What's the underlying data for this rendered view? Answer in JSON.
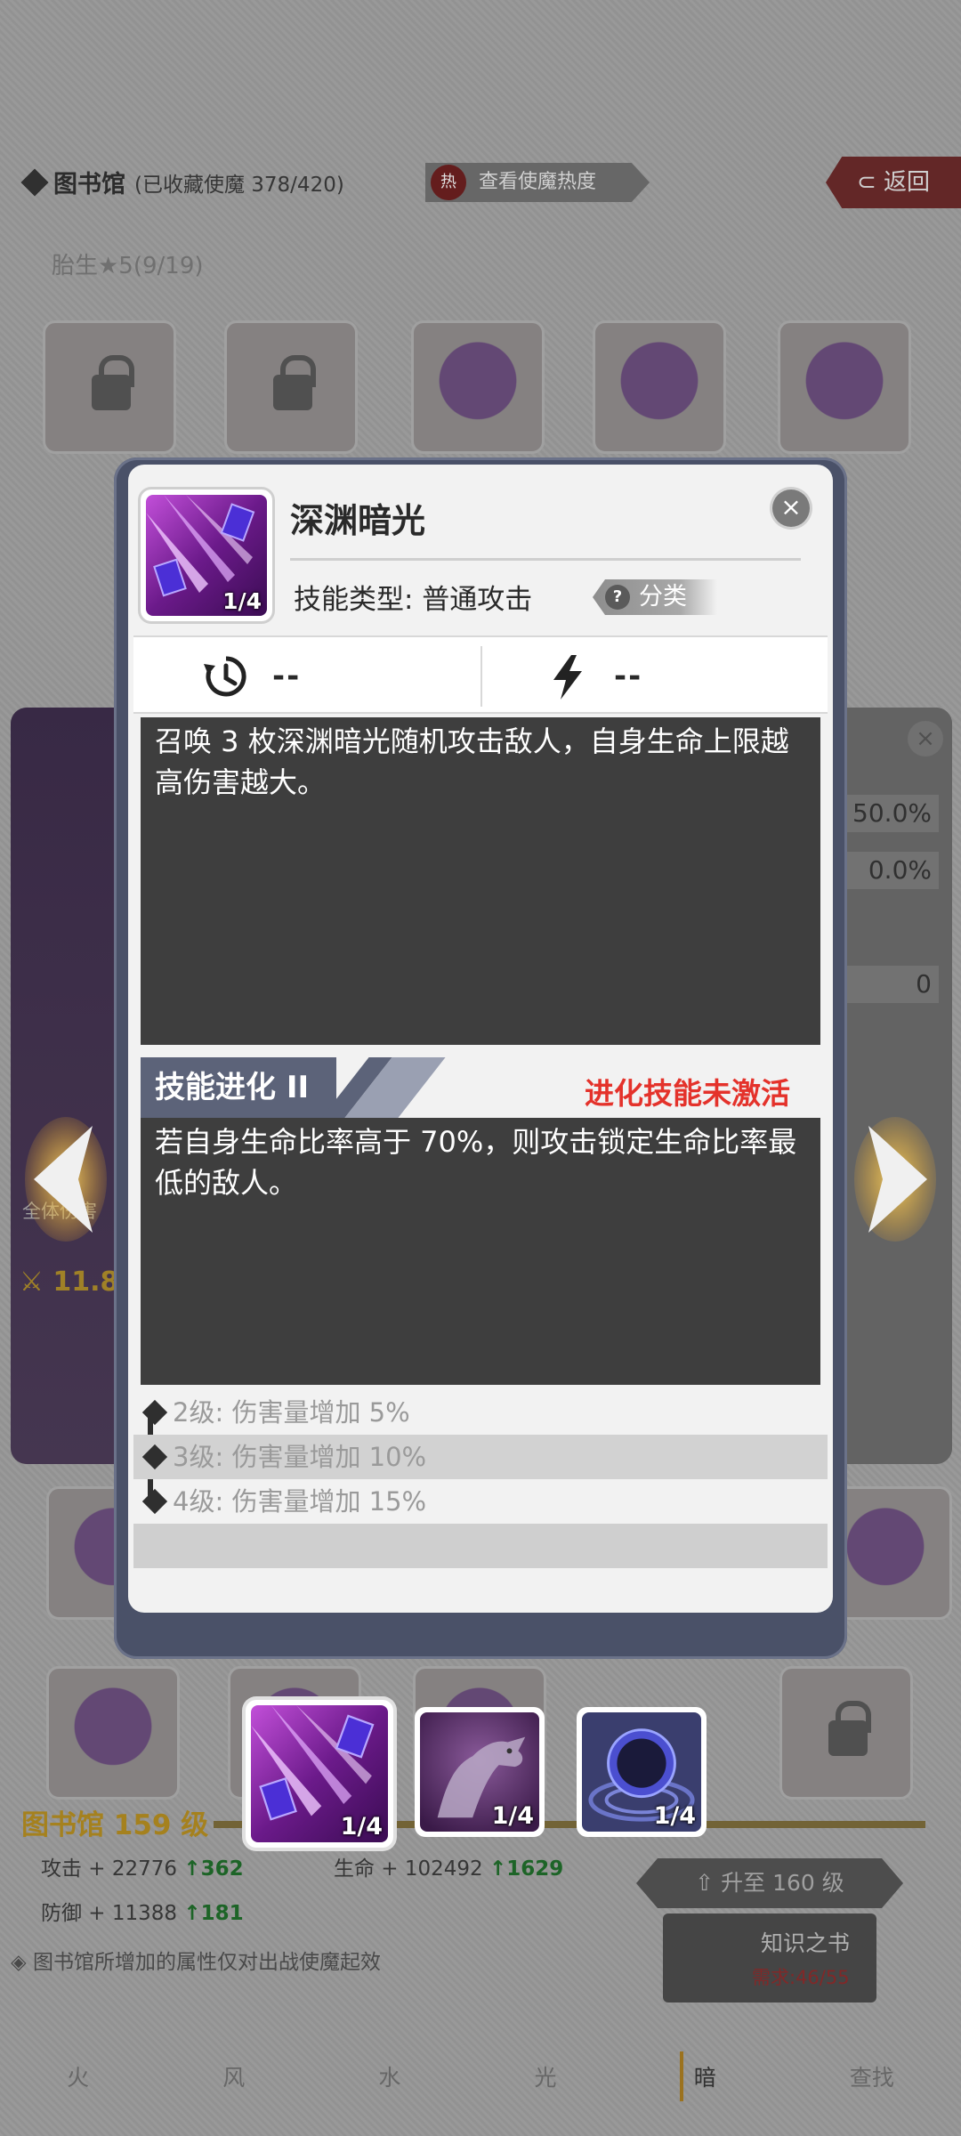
{
  "background": {
    "title": "图书馆",
    "collected": "(已收藏使魔 378/420)",
    "hot_button": "查看使魔热度",
    "hot_icon": "热",
    "back_button": "返回",
    "tier_label": "胎生★5(9/19)",
    "percent_values": [
      "50.0%",
      "0.0%",
      "0"
    ],
    "power_value": "11.8",
    "all_body_label": "全体伤害",
    "library_level": "图书馆 159 级",
    "stats": {
      "attack_label": "攻击 + 22776",
      "attack_up": "↑362",
      "hp_label": "生命 + 102492",
      "hp_up": "↑1629",
      "defense_label": "防御 + 11388",
      "defense_up": "↑181"
    },
    "upgrade_button": "升至 160 级",
    "book_title": "知识之书",
    "book_requirement": "需求:46/55",
    "note": "图书馆所增加的属性仅对出战使魔起效",
    "tabs": [
      "火",
      "风",
      "水",
      "光",
      "暗",
      "查找"
    ],
    "active_tab": "暗"
  },
  "dialog": {
    "skill_name": "深渊暗光",
    "skill_level": "1/4",
    "skill_type_label": "技能类型: 普通攻击",
    "category_tag": "分类",
    "category_q": "?",
    "cooldown_value": "--",
    "energy_value": "--",
    "description": "召唤 3 枚深渊暗光随机攻击敌人，自身生命上限越高伤害越大。",
    "evolution_title": "技能进化 II",
    "evolution_status": "进化技能未激活",
    "evolution_description": "若自身生命比率高于 70%，则攻击锁定生命比率最低的敌人。",
    "levels": [
      {
        "text": "2级: 伤害量增加 5%"
      },
      {
        "text": "3级: 伤害量增加 10%"
      },
      {
        "text": "4级: 伤害量增加 15%"
      }
    ],
    "close_icon": "×"
  },
  "skill_strip": [
    {
      "name": "深渊暗光",
      "level": "1/4",
      "selected": true
    },
    {
      "name": "skill-2",
      "level": "1/4",
      "selected": false
    },
    {
      "name": "skill-3",
      "level": "1/4",
      "selected": false
    }
  ],
  "colors": {
    "dialog_frame": "#4a5168",
    "evolution_tab": "#5c6379",
    "inactive_red": "#e4322b",
    "desc_bg": "#3e3e3e",
    "skill_purple": "#7a2a9a"
  },
  "icons": {
    "cooldown": "clock-history-icon",
    "energy": "lightning-icon",
    "close": "close-icon",
    "help": "question-icon",
    "nav_left": "chevron-left-icon",
    "nav_right": "chevron-right-icon"
  }
}
